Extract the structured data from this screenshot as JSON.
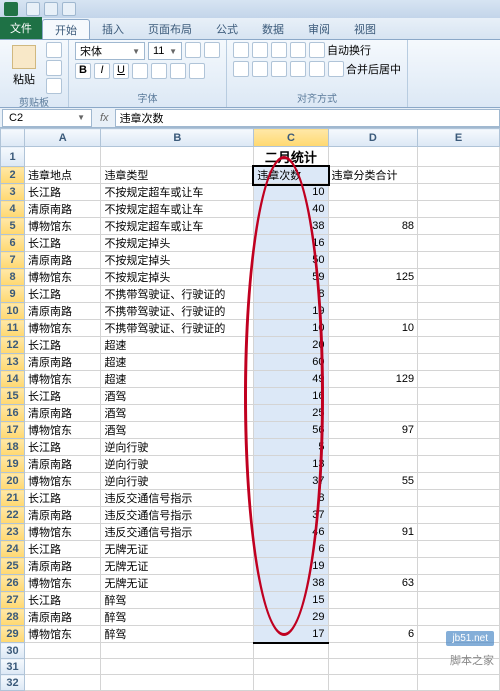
{
  "qat_title": "Excel",
  "tabs": {
    "file": "文件",
    "home": "开始",
    "insert": "插入",
    "layout": "页面布局",
    "formulas": "公式",
    "data": "数据",
    "review": "审阅",
    "view": "视图"
  },
  "ribbon": {
    "clipboard": {
      "label": "剪贴板",
      "paste": "粘贴"
    },
    "font": {
      "label": "字体",
      "name": "宋体",
      "size": "11",
      "bold": "B",
      "italic": "I",
      "underline": "U"
    },
    "align": {
      "label": "对齐方式",
      "wrap": "自动换行",
      "merge": "合并后居中"
    }
  },
  "namebox": "C2",
  "fx": "fx",
  "formula_value": "违章次数",
  "cols": [
    "",
    "A",
    "B",
    "C",
    "D",
    "E"
  ],
  "title_row": "二月统计",
  "headers": {
    "a": "违章地点",
    "b": "违章类型",
    "c": "违章次数",
    "d": "违章分类合计"
  },
  "rows": [
    {
      "r": 3,
      "a": "长江路",
      "b": "不按规定超车或让车",
      "c": 10,
      "d": ""
    },
    {
      "r": 4,
      "a": "清原南路",
      "b": "不按规定超车或让车",
      "c": 40,
      "d": ""
    },
    {
      "r": 5,
      "a": "博物馆东",
      "b": "不按规定超车或让车",
      "c": 38,
      "d": 88
    },
    {
      "r": 6,
      "a": "长江路",
      "b": "不按规定掉头",
      "c": 16,
      "d": ""
    },
    {
      "r": 7,
      "a": "清原南路",
      "b": "不按规定掉头",
      "c": 50,
      "d": ""
    },
    {
      "r": 8,
      "a": "博物馆东",
      "b": "不按规定掉头",
      "c": 59,
      "d": 125
    },
    {
      "r": 9,
      "a": "长江路",
      "b": "不携带驾驶证、行驶证的",
      "c": 8,
      "d": ""
    },
    {
      "r": 10,
      "a": "清原南路",
      "b": "不携带驾驶证、行驶证的",
      "c": 19,
      "d": ""
    },
    {
      "r": 11,
      "a": "博物馆东",
      "b": "不携带驾驶证、行驶证的",
      "c": 10,
      "d": 10
    },
    {
      "r": 12,
      "a": "长江路",
      "b": "超速",
      "c": 20,
      "d": ""
    },
    {
      "r": 13,
      "a": "清原南路",
      "b": "超速",
      "c": 60,
      "d": ""
    },
    {
      "r": 14,
      "a": "博物馆东",
      "b": "超速",
      "c": 49,
      "d": 129
    },
    {
      "r": 15,
      "a": "长江路",
      "b": "酒驾",
      "c": 16,
      "d": ""
    },
    {
      "r": 16,
      "a": "清原南路",
      "b": "酒驾",
      "c": 25,
      "d": ""
    },
    {
      "r": 17,
      "a": "博物馆东",
      "b": "酒驾",
      "c": 56,
      "d": 97
    },
    {
      "r": 18,
      "a": "长江路",
      "b": "逆向行驶",
      "c": 5,
      "d": ""
    },
    {
      "r": 19,
      "a": "清原南路",
      "b": "逆向行驶",
      "c": 13,
      "d": ""
    },
    {
      "r": 20,
      "a": "博物馆东",
      "b": "逆向行驶",
      "c": 37,
      "d": 55
    },
    {
      "r": 21,
      "a": "长江路",
      "b": "违反交通信号指示",
      "c": 8,
      "d": ""
    },
    {
      "r": 22,
      "a": "清原南路",
      "b": "违反交通信号指示",
      "c": 37,
      "d": ""
    },
    {
      "r": 23,
      "a": "博物馆东",
      "b": "违反交通信号指示",
      "c": 46,
      "d": 91
    },
    {
      "r": 24,
      "a": "长江路",
      "b": "无牌无证",
      "c": 6,
      "d": ""
    },
    {
      "r": 25,
      "a": "清原南路",
      "b": "无牌无证",
      "c": 19,
      "d": ""
    },
    {
      "r": 26,
      "a": "博物馆东",
      "b": "无牌无证",
      "c": 38,
      "d": 63
    },
    {
      "r": 27,
      "a": "长江路",
      "b": "醉驾",
      "c": 15,
      "d": ""
    },
    {
      "r": 28,
      "a": "清原南路",
      "b": "醉驾",
      "c": 29,
      "d": ""
    },
    {
      "r": 29,
      "a": "博物馆东",
      "b": "醉驾",
      "c": 17,
      "d": 6
    }
  ],
  "empty_rows": [
    30,
    31,
    32
  ],
  "watermark": "jb51.net",
  "footer": "脚本之家"
}
